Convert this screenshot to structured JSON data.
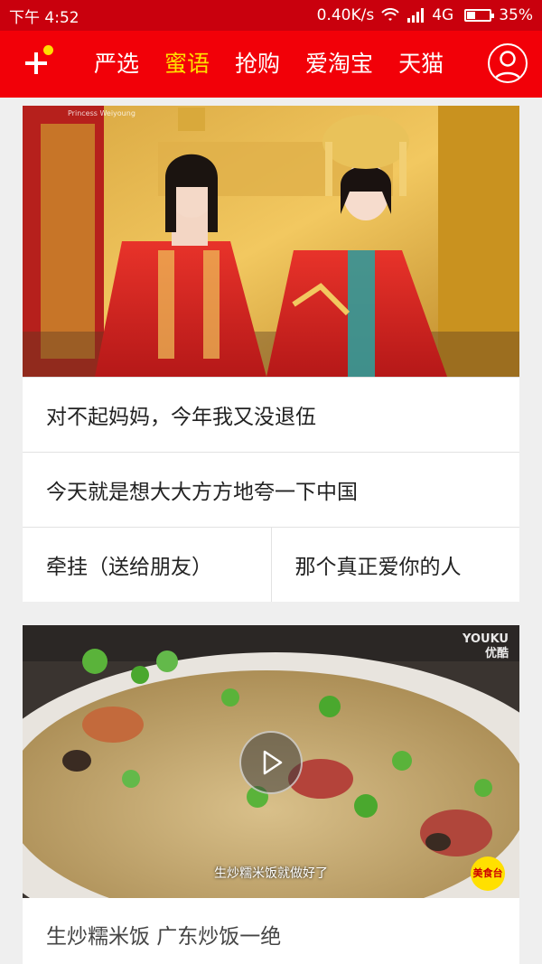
{
  "status_bar": {
    "time": "下午 4:52",
    "network_speed": "0.40K/s",
    "network_type": "4G",
    "battery": "35%"
  },
  "top_nav": {
    "tabs": [
      {
        "label": "严选",
        "active": false
      },
      {
        "label": "蜜语",
        "active": true
      },
      {
        "label": "抢购",
        "active": false
      },
      {
        "label": "爱淘宝",
        "active": false
      },
      {
        "label": "天猫",
        "active": false
      }
    ],
    "accent_color": "#f20008",
    "active_color": "#ffe000"
  },
  "feed": {
    "card1": {
      "image_icon": "wedding-drama-photo",
      "image_watermark": "Princess Weiyoung",
      "rows": [
        "对不起妈妈，今年我又没退伍",
        "今天就是想大大方方地夸一下中国"
      ],
      "split_row": [
        "牵挂（送给朋友）",
        "那个真正爱你的人"
      ]
    },
    "card2": {
      "image_icon": "fried-rice-video",
      "logo_line1": "YOUKU",
      "logo_line2": "优酷",
      "subtitle": "生炒糯米饭就做好了",
      "badge": "美食台",
      "caption": "生炒糯米饭  广东炒饭一绝"
    }
  }
}
